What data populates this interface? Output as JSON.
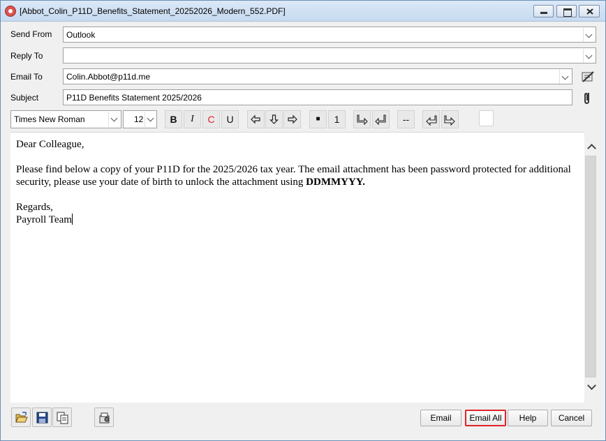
{
  "window": {
    "title": "[Abbot_Colin_P11D_Benefits_Statement_20252026_Modern_552.PDF]"
  },
  "form": {
    "send_from_label": "Send From",
    "send_from_value": "Outlook",
    "reply_to_label": "Reply To",
    "reply_to_value": "",
    "email_to_label": "Email To",
    "email_to_value": "Colin.Abbot@p11d.me",
    "subject_label": "Subject",
    "subject_value": "P11D Benefits Statement 2025/2026"
  },
  "toolbar": {
    "font_name": "Times New Roman",
    "font_size": "12",
    "bold": "B",
    "italic": "I",
    "color": "C",
    "underline": "U",
    "bullet": "■",
    "numbering": "1",
    "hr": "--",
    "color_accent": "#e1232a"
  },
  "body": {
    "greeting": "Dear Colleague,",
    "paragraph_start": "Please find below a copy of your P11D for the 2025/2026 tax year. The email attachment has been password protected for additional security, please use your date of birth to unlock the attachment using ",
    "paragraph_bold": "DDMMYYY.",
    "signoff": "Regards,",
    "signature": "Payroll Team"
  },
  "buttons": {
    "email": "Email",
    "email_all": "Email All",
    "help": "Help",
    "cancel": "Cancel"
  },
  "icons": {
    "open": "folder-open-icon",
    "save": "save-icon",
    "copy": "copy-icon",
    "settings": "settings-icon",
    "address_book": "address-book-icon",
    "attachment": "paperclip-icon"
  }
}
